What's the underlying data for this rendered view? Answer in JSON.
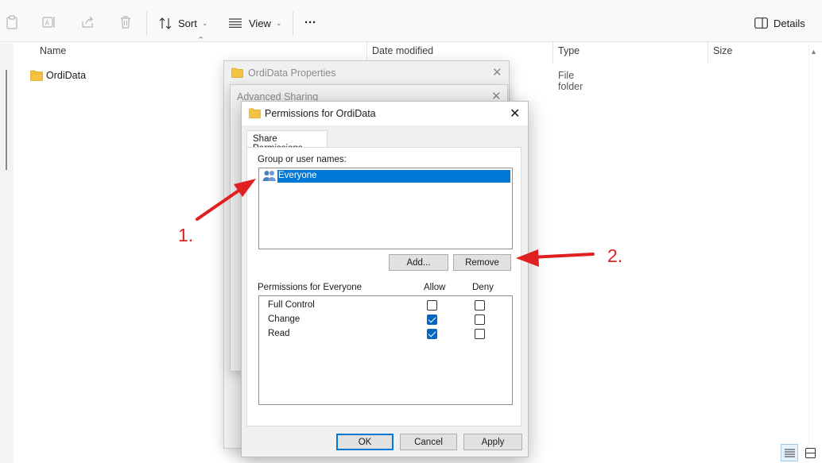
{
  "toolbar": {
    "sort_label": "Sort",
    "view_label": "View",
    "more_label": "···",
    "details_label": "Details"
  },
  "file_list": {
    "columns": [
      "Name",
      "Date modified",
      "Type",
      "Size"
    ],
    "rows": [
      {
        "name": "OrdiData",
        "date_modified": "",
        "type": "File folder",
        "size": ""
      }
    ]
  },
  "dialogs": {
    "properties_title": "OrdiData Properties",
    "advanced_sharing_title": "Advanced Sharing",
    "permissions": {
      "title": "Permissions for OrdiData",
      "tab_label": "Share Permissions",
      "group_label": "Group or user names:",
      "users": [
        "Everyone"
      ],
      "add_label": "Add...",
      "remove_label": "Remove",
      "perm_for_label": "Permissions for Everyone",
      "allow_header": "Allow",
      "deny_header": "Deny",
      "permissions": [
        {
          "name": "Full Control",
          "allow": false,
          "deny": false
        },
        {
          "name": "Change",
          "allow": true,
          "deny": false
        },
        {
          "name": "Read",
          "allow": true,
          "deny": false
        }
      ],
      "ok_label": "OK",
      "cancel_label": "Cancel",
      "apply_label": "Apply"
    }
  },
  "annotations": {
    "step1": "1.",
    "step2": "2."
  },
  "colors": {
    "selection": "#0078d7",
    "arrow": "#e02020",
    "folder": "#f5c342"
  }
}
